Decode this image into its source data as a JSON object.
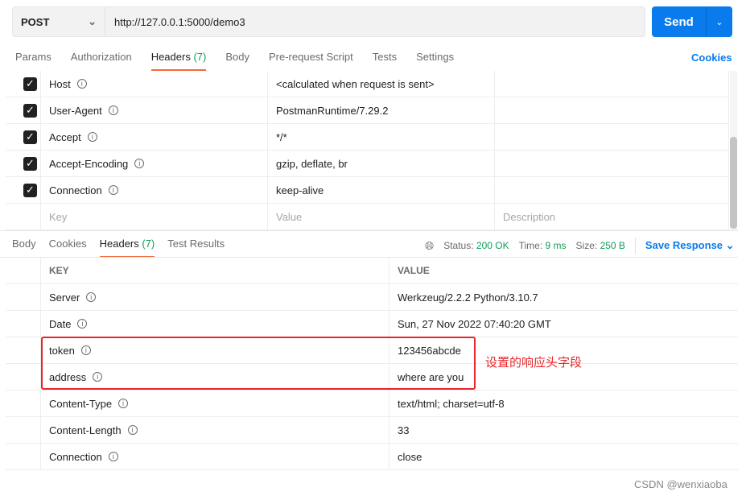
{
  "request": {
    "method": "POST",
    "url": "http://127.0.0.1:5000/demo3",
    "send_label": "Send"
  },
  "req_tabs": [
    {
      "label": "Params"
    },
    {
      "label": "Authorization"
    },
    {
      "label": "Headers",
      "count": "(7)"
    },
    {
      "label": "Body"
    },
    {
      "label": "Pre-request Script"
    },
    {
      "label": "Tests"
    },
    {
      "label": "Settings"
    }
  ],
  "cookies_label": "Cookies",
  "req_headers": [
    {
      "key": "Host",
      "value": "<calculated when request is sent>"
    },
    {
      "key": "User-Agent",
      "value": "PostmanRuntime/7.29.2"
    },
    {
      "key": "Accept",
      "value": "*/*"
    },
    {
      "key": "Accept-Encoding",
      "value": "gzip, deflate, br"
    },
    {
      "key": "Connection",
      "value": "keep-alive"
    }
  ],
  "req_placeholders": {
    "key": "Key",
    "value": "Value",
    "description": "Description"
  },
  "resp_tabs": [
    {
      "label": "Body"
    },
    {
      "label": "Cookies"
    },
    {
      "label": "Headers",
      "count": "(7)"
    },
    {
      "label": "Test Results"
    }
  ],
  "status": {
    "status_label": "Status:",
    "status": "200 OK",
    "time_label": "Time:",
    "time": "9 ms",
    "size_label": "Size:",
    "size": "250 B",
    "save_label": "Save Response"
  },
  "resp_columns": {
    "key": "KEY",
    "value": "VALUE"
  },
  "resp_headers": [
    {
      "key": "Server",
      "value": "Werkzeug/2.2.2 Python/3.10.7"
    },
    {
      "key": "Date",
      "value": "Sun, 27 Nov 2022 07:40:20 GMT"
    },
    {
      "key": "token",
      "value": "123456abcde"
    },
    {
      "key": "address",
      "value": "where are you"
    },
    {
      "key": "Content-Type",
      "value": "text/html; charset=utf-8"
    },
    {
      "key": "Content-Length",
      "value": "33"
    },
    {
      "key": "Connection",
      "value": "close"
    }
  ],
  "annotation": "设置的响应头字段",
  "watermark": "CSDN @wenxiaoba",
  "colors": {
    "accent": "#097bed",
    "tab_underline": "#f26b3a",
    "status": "#0f9d58",
    "annotation": "#e8262a"
  }
}
